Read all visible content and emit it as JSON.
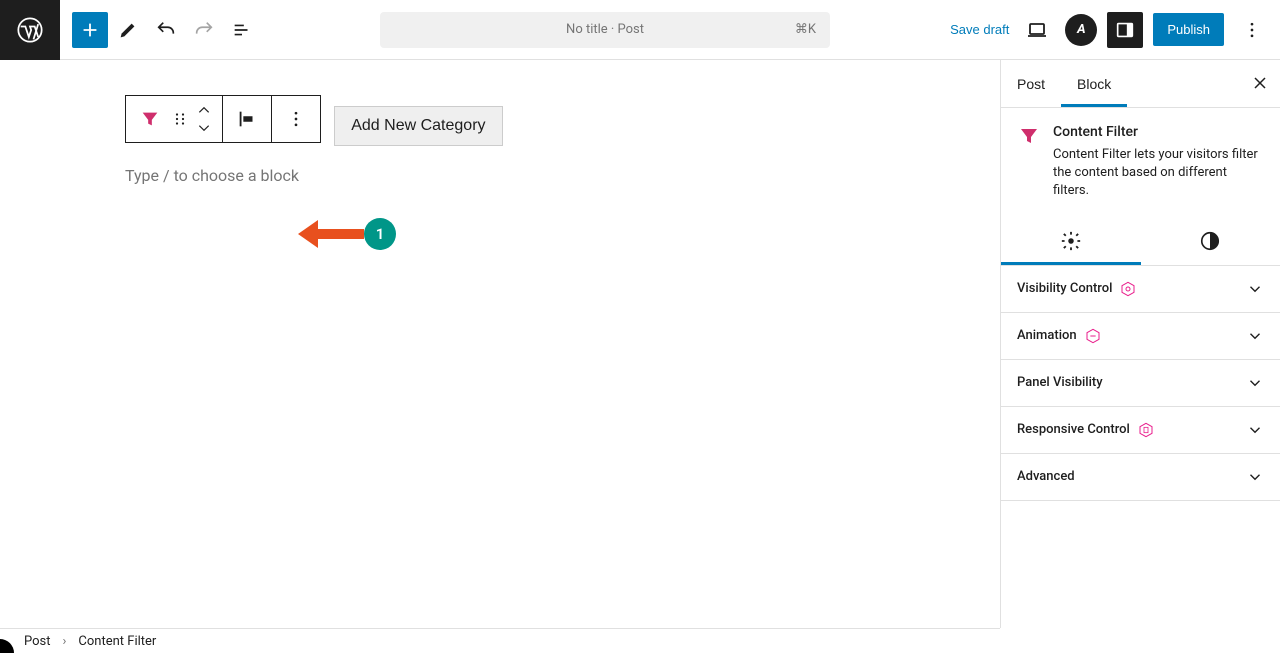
{
  "topbar": {
    "doc_title": "No title · Post",
    "kbd_shortcut": "⌘K",
    "save_draft": "Save draft",
    "publish": "Publish"
  },
  "editor": {
    "add_category_label": "Add New Category",
    "placeholder": "Type / to choose a block"
  },
  "annotation": {
    "badge_number": "1"
  },
  "sidebar": {
    "tabs": {
      "post": "Post",
      "block": "Block"
    },
    "block_title": "Content Filter",
    "block_desc": "Content Filter lets your visitors filter the content based on different filters.",
    "panels": {
      "visibility": "Visibility Control",
      "animation": "Animation",
      "panel_visibility": "Panel Visibility",
      "responsive": "Responsive Control",
      "advanced": "Advanced"
    }
  },
  "breadcrumb": {
    "root": "Post",
    "current": "Content Filter"
  },
  "colors": {
    "accent": "#007cba",
    "filter_icon": "#cf2e6c",
    "badge": "#009688",
    "arrow": "#e8501e"
  }
}
